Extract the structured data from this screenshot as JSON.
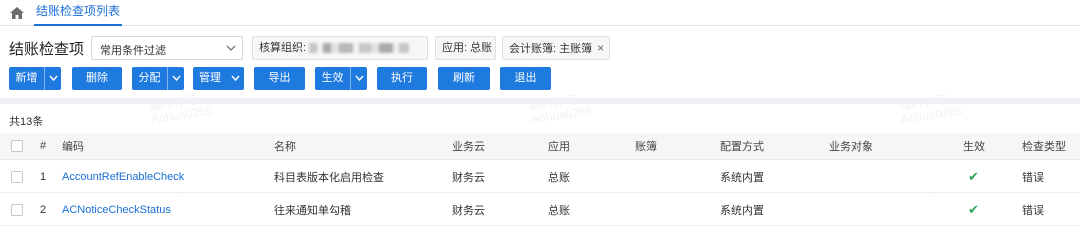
{
  "tabs": [
    {
      "label": "结账检查项列表"
    }
  ],
  "page": {
    "title": "结账检查项"
  },
  "filter": {
    "selected": "常用条件过滤"
  },
  "chips": [
    {
      "label": "核算组织:"
    },
    {
      "label": "应用: 总账"
    },
    {
      "label": "会计账簿: 主账簿",
      "close": "×"
    }
  ],
  "toolbar": {
    "new_label": "新增",
    "delete_label": "删除",
    "assign_label": "分配",
    "manage_label": "管理",
    "export_label": "导出",
    "effective_label": "生效",
    "execute_label": "执行",
    "refresh_label": "刷新",
    "exit_label": "退出"
  },
  "count_text": "共13条",
  "table": {
    "headers": {
      "index": "#",
      "code": "编码",
      "name": "名称",
      "cloud": "业务云",
      "app": "应用",
      "book": "账簿",
      "config": "配置方式",
      "object": "业务对象",
      "effective": "生效",
      "type": "检查类型"
    },
    "rows": [
      {
        "index": "1",
        "code": "AccountRefEnableCheck",
        "name": "科目表版本化启用检查",
        "cloud": "财务云",
        "app": "总账",
        "book": "",
        "config": "系统内置",
        "object": "",
        "effective": "✔",
        "type": "错误"
      },
      {
        "index": "2",
        "code": "ACNoticeCheckStatus",
        "name": "往来通知单勾稽",
        "cloud": "财务云",
        "app": "总账",
        "book": "",
        "config": "系统内置",
        "object": "",
        "effective": "✔",
        "type": "错误"
      }
    ]
  },
  "watermark": {
    "line1": "临时许可",
    "line2": "Aohua0265"
  },
  "colors": {
    "primary": "#1f7ae0",
    "link": "#1a6fd6",
    "check": "#2aa657"
  }
}
